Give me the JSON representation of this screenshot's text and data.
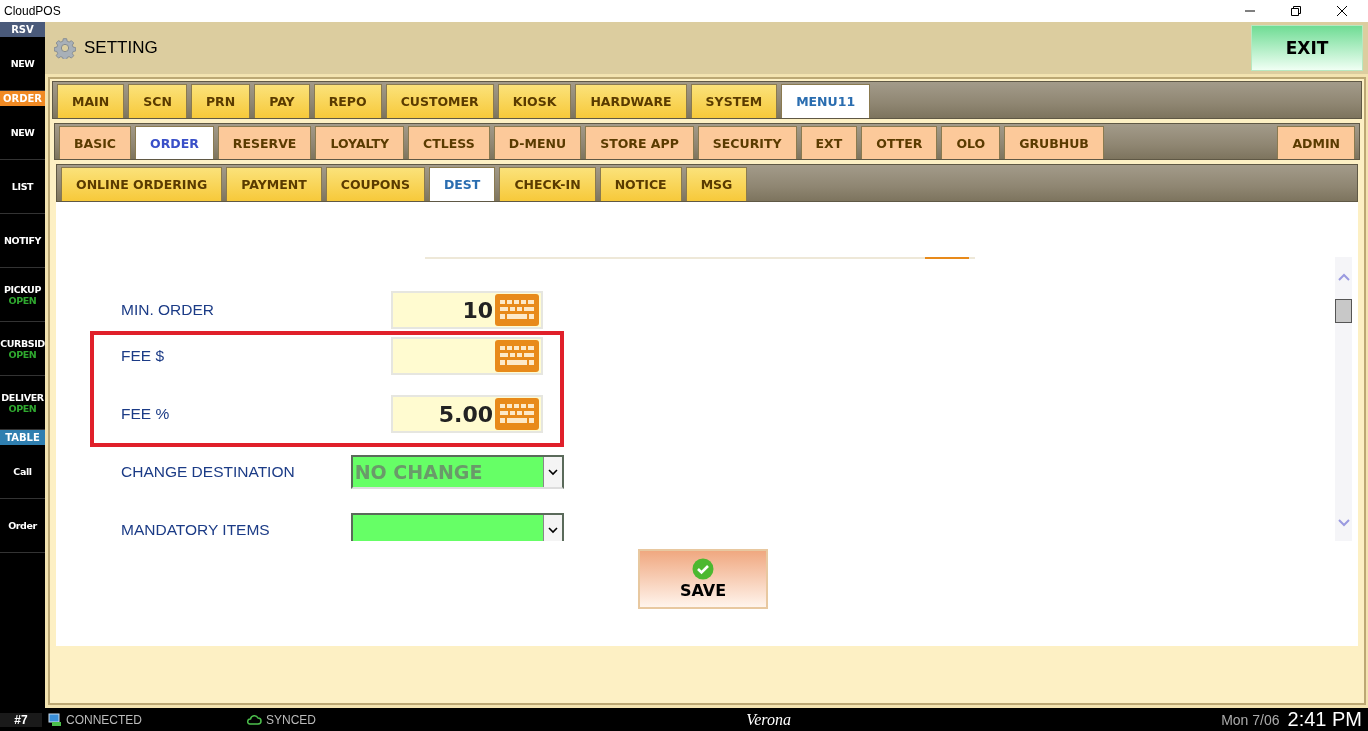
{
  "window": {
    "title": "CloudPOS"
  },
  "sidebar": {
    "items": [
      {
        "kind": "header",
        "label": "RSV",
        "color": "#4a5a7a"
      },
      {
        "kind": "item",
        "label": "NEW"
      },
      {
        "kind": "header",
        "label": "ORDER",
        "color": "#f08a24"
      },
      {
        "kind": "item",
        "label": "NEW"
      },
      {
        "kind": "item",
        "label": "LIST"
      },
      {
        "kind": "item",
        "label": "NOTIFY"
      },
      {
        "kind": "item",
        "label": "PICKUP",
        "status": "OPEN"
      },
      {
        "kind": "item",
        "label": "CURBSID",
        "status": "OPEN"
      },
      {
        "kind": "item",
        "label": "DELIVER",
        "status": "OPEN"
      },
      {
        "kind": "header",
        "label": "TABLE",
        "color": "#2f7fb0"
      },
      {
        "kind": "item",
        "label": "Call"
      },
      {
        "kind": "item",
        "label": "Order"
      }
    ]
  },
  "header": {
    "title": "SETTING",
    "exit_button": "EXIT"
  },
  "tabs_main": [
    {
      "label": "MAIN",
      "selected": false
    },
    {
      "label": "SCN",
      "selected": false
    },
    {
      "label": "PRN",
      "selected": false
    },
    {
      "label": "PAY",
      "selected": false
    },
    {
      "label": "REPO",
      "selected": false
    },
    {
      "label": "CUSTOMER",
      "selected": false
    },
    {
      "label": "KIOSK",
      "selected": false
    },
    {
      "label": "HARDWARE",
      "selected": false
    },
    {
      "label": "SYSTEM",
      "selected": false
    },
    {
      "label": "MENU11",
      "selected": true
    }
  ],
  "tabs_sub": [
    {
      "label": "BASIC",
      "selected": false
    },
    {
      "label": "ORDER",
      "selected": true
    },
    {
      "label": "RESERVE",
      "selected": false
    },
    {
      "label": "LOYALTY",
      "selected": false
    },
    {
      "label": "CTLESS",
      "selected": false
    },
    {
      "label": "D-MENU",
      "selected": false
    },
    {
      "label": "STORE APP",
      "selected": false
    },
    {
      "label": "SECURITY",
      "selected": false
    },
    {
      "label": "EXT",
      "selected": false
    },
    {
      "label": "OTTER",
      "selected": false
    },
    {
      "label": "OLO",
      "selected": false
    },
    {
      "label": "GRUBHUB",
      "selected": false
    }
  ],
  "admin_tab": {
    "label": "ADMIN",
    "selected": false
  },
  "tabs_order": [
    {
      "label": "ONLINE ORDERING",
      "selected": false
    },
    {
      "label": "PAYMENT",
      "selected": false
    },
    {
      "label": "COUPONS",
      "selected": false
    },
    {
      "label": "DEST",
      "selected": true
    },
    {
      "label": "CHECK-IN",
      "selected": false
    },
    {
      "label": "NOTICE",
      "selected": false
    },
    {
      "label": "MSG",
      "selected": false
    }
  ],
  "fields": [
    {
      "kind": "numeric",
      "label": "MIN. ORDER",
      "value": "10",
      "highlighted": false
    },
    {
      "kind": "numeric",
      "label": "FEE $",
      "highlighted": true
    },
    {
      "kind": "numeric",
      "label": "FEE %",
      "value": "5.00",
      "highlighted": true
    },
    {
      "kind": "dropdown",
      "label": "CHANGE DESTINATION",
      "value": "NO CHANGE",
      "highlighted": false
    },
    {
      "kind": "dropdown",
      "label": "MANDATORY ITEMS",
      "highlighted": false
    }
  ],
  "save_button": "SAVE",
  "status_bar": {
    "station": "#7",
    "connection": "CONNECTED",
    "sync": "SYNCED",
    "store": "Verona",
    "date": "Mon 7/06",
    "time": "2:41 PM"
  }
}
